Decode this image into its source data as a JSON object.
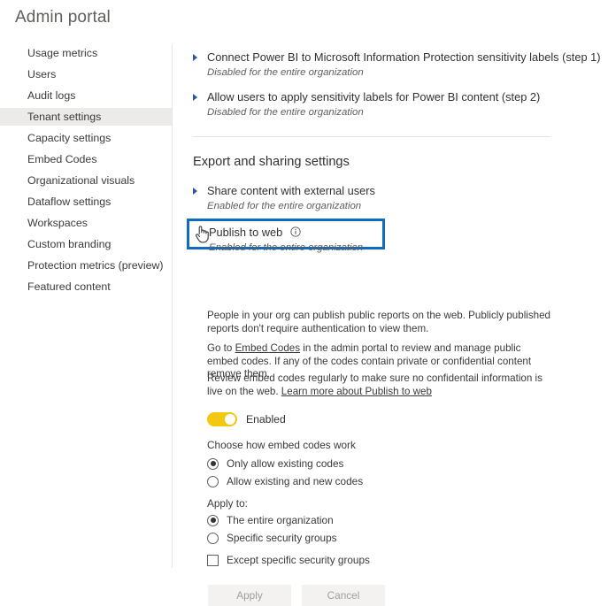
{
  "page": {
    "title": "Admin portal"
  },
  "sidebar": {
    "items": [
      {
        "label": "Usage metrics",
        "selected": false
      },
      {
        "label": "Users",
        "selected": false
      },
      {
        "label": "Audit logs",
        "selected": false
      },
      {
        "label": "Tenant settings",
        "selected": true
      },
      {
        "label": "Capacity settings",
        "selected": false
      },
      {
        "label": "Embed Codes",
        "selected": false
      },
      {
        "label": "Organizational visuals",
        "selected": false
      },
      {
        "label": "Dataflow settings",
        "selected": false
      },
      {
        "label": "Workspaces",
        "selected": false
      },
      {
        "label": "Custom branding",
        "selected": false
      },
      {
        "label": "Protection metrics (preview)",
        "selected": false
      },
      {
        "label": "Featured content",
        "selected": false
      }
    ]
  },
  "main": {
    "settings_above": [
      {
        "title": "Connect Power BI to Microsoft Information Protection sensitivity labels (step 1)",
        "status": "Disabled for the entire organization"
      },
      {
        "title": "Allow users to apply sensitivity labels for Power BI content (step 2)",
        "status": "Disabled for the entire organization"
      }
    ],
    "section_heading": "Export and sharing settings",
    "share_setting": {
      "title": "Share content with external users",
      "status": "Enabled for the entire organization"
    },
    "publish_to_web": {
      "title": "Publish to web",
      "status": "Enabled for the entire organization",
      "info_icon": "info-circle-icon",
      "cursor_icon": "hand-pointer-cursor-icon",
      "highlight_color": "#0f6cbd"
    },
    "description": {
      "paragraph1": "People in your org can publish public reports on the web. Publicly published reports don't require authentication to view them.",
      "paragraph2_before": "Go to ",
      "paragraph2_link": "Embed Codes",
      "paragraph2_after": " in the admin portal to review and manage public embed codes. If any of the codes contain private or confidential content remove them.",
      "paragraph3_before": "Review embed codes regularly to make sure no confidentail information is live on the web. ",
      "paragraph3_link": "Learn more about Publish to web"
    },
    "toggle": {
      "label": "Enabled",
      "state": "on",
      "color": "#f2c811"
    },
    "embed_codes_group": {
      "label": "Choose how embed codes work",
      "options": [
        {
          "label": "Only allow existing codes",
          "selected": true
        },
        {
          "label": "Allow existing and new codes",
          "selected": false
        }
      ]
    },
    "apply_to_group": {
      "label": "Apply to:",
      "options": [
        {
          "label": "The entire organization",
          "selected": true
        },
        {
          "label": "Specific security groups",
          "selected": false
        }
      ],
      "checkbox": {
        "label": "Except specific security groups",
        "checked": false
      }
    },
    "buttons": {
      "apply": "Apply",
      "cancel": "Cancel"
    }
  }
}
